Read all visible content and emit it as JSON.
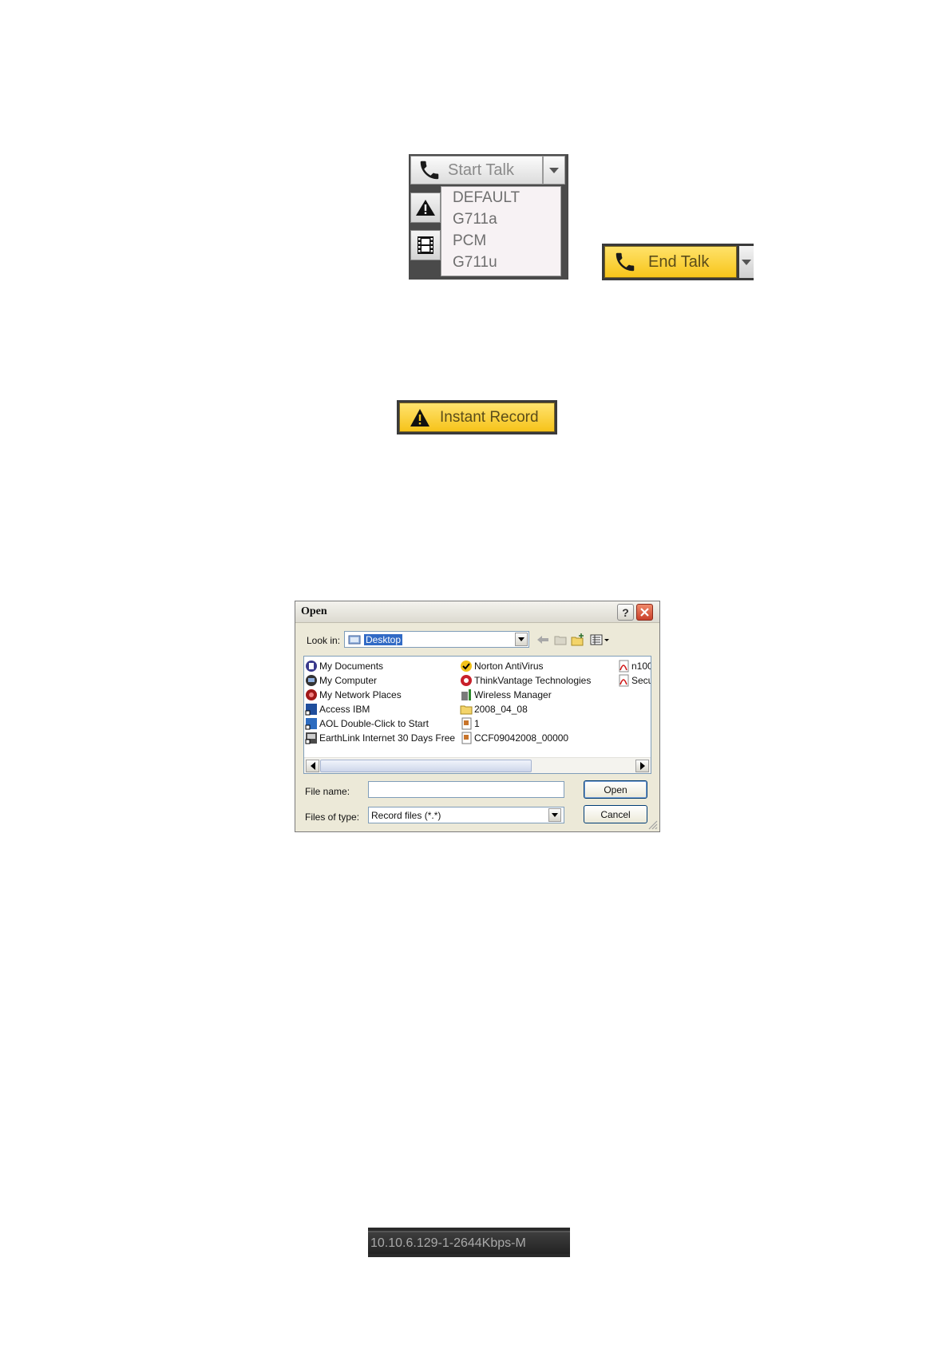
{
  "talk": {
    "start_label": "Start Talk",
    "codec_options": [
      "DEFAULT",
      "G711a",
      "PCM",
      "G711u"
    ],
    "end_label": "End Talk"
  },
  "record": {
    "instant_label": "Instant Record"
  },
  "dialog": {
    "title": "Open",
    "help_symbol": "?",
    "lookin_label": "Look in:",
    "lookin_value": "Desktop",
    "files": [
      {
        "name": "My Documents",
        "icon": "my-documents-icon"
      },
      {
        "name": "My Computer",
        "icon": "my-computer-icon"
      },
      {
        "name": "My Network Places",
        "icon": "network-places-icon"
      },
      {
        "name": "Access IBM",
        "icon": "shortcut-icon"
      },
      {
        "name": "AOL Double-Click to Start",
        "icon": "shortcut-icon"
      },
      {
        "name": "EarthLink Internet 30 Days Free",
        "icon": "shortcut-icon"
      },
      {
        "name": "Norton AntiVirus",
        "icon": "norton-icon"
      },
      {
        "name": "ThinkVantage Technologies",
        "icon": "thinkvantage-icon"
      },
      {
        "name": "Wireless Manager",
        "icon": "wireless-icon"
      },
      {
        "name": "2008_04_08",
        "icon": "folder-icon"
      },
      {
        "name": "1",
        "icon": "record-file-icon"
      },
      {
        "name": "CCF09042008_00000",
        "icon": "record-file-icon"
      },
      {
        "name": "n100",
        "icon": "pdf-icon"
      },
      {
        "name": "Secu",
        "icon": "pdf-icon"
      }
    ],
    "filename_label": "File name:",
    "filename_value": "",
    "filetype_label": "Files of type:",
    "filetype_value": "Record files (*.*)",
    "open_label": "Open",
    "cancel_label": "Cancel"
  },
  "channel": {
    "label": "10.10.6.129-1-2644Kbps-M"
  },
  "colors": {
    "accent_yellow": "#f7c51a",
    "selection_blue": "#316ac5",
    "dark_panel": "#4a4a4a"
  }
}
